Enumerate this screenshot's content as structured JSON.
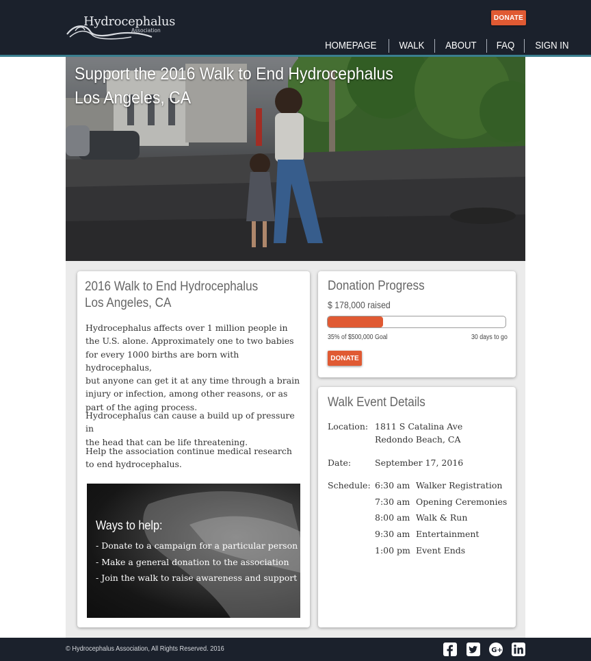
{
  "header": {
    "logo_text": "Hydrocephalus",
    "logo_sub": "Association",
    "donate_label": "DONATE",
    "nav": [
      "HOMEPAGE",
      "WALK",
      "ABOUT",
      "FAQ",
      "SIGN IN"
    ]
  },
  "hero": {
    "title_line1": "Support the 2016 Walk to End Hydrocephalus",
    "title_line2": "Los Angeles, CA"
  },
  "left_card": {
    "title_line1": "2016 Walk to End Hydrocephalus",
    "title_line2": "Los Angeles, CA",
    "paragraph1": [
      "Hydrocephalus affects over 1 million people in",
      "the U.S. alone. Approximately one to two babies",
      "for every 1000 births are born with hydrocephalus,",
      "but anyone can get it at any time through a brain",
      "injury or infection, among other reasons, or as",
      "part of the aging process."
    ],
    "paragraph2": [
      "Hydrocephalus can cause a build up of pressure in",
      "the head that can be life threatening."
    ],
    "paragraph3": [
      "Help the association continue medical research",
      "to end hydrocephalus."
    ],
    "ways_heading": "Ways to help:",
    "ways_items": [
      "- Donate to a campaign for a particular person",
      "- Make a general donation to the association",
      "- Join the walk to raise awareness and support"
    ]
  },
  "progress": {
    "title": "Donation Progress",
    "raised": "$ 178,000 raised",
    "fraction": 0.31,
    "goal_text": "35% of $500,000 Goal",
    "days_text": "30 days to go",
    "donate_label": "DONATE",
    "accent": "#e05a33"
  },
  "details": {
    "title": "Walk Event Details",
    "location_label": "Location:",
    "location_line1": "1811 S Catalina Ave",
    "location_line2": "Redondo Beach, CA",
    "date_label": "Date:",
    "date_value": "September 17, 2016",
    "schedule_label": "Schedule:",
    "schedule": [
      {
        "time": "6:30 am",
        "event": "Walker Registration"
      },
      {
        "time": "7:30 am",
        "event": "Opening Ceremonies"
      },
      {
        "time": "8:00 am",
        "event": "Walk & Run"
      },
      {
        "time": "9:30 am",
        "event": "Entertainment"
      },
      {
        "time": "1:00 pm",
        "event": "Event Ends"
      }
    ]
  },
  "footer": {
    "copyright": "©  Hydrocephalus Association, All Rights Reserved. 2016",
    "social": [
      "facebook-icon",
      "twitter-icon",
      "google-plus-icon",
      "linkedin-icon"
    ]
  }
}
